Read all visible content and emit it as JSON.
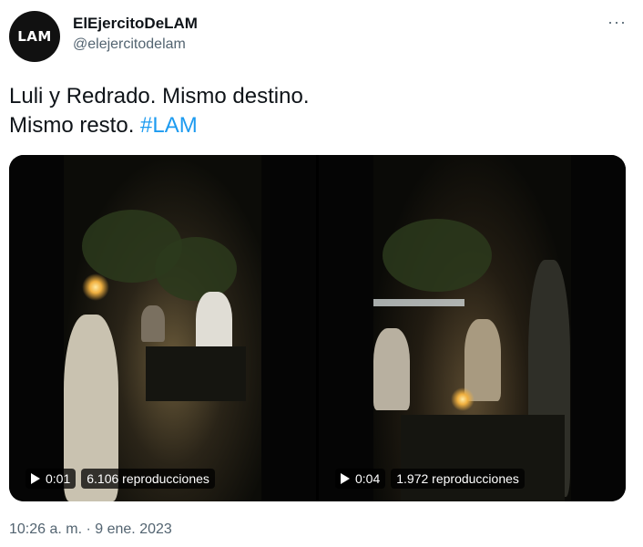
{
  "author": {
    "avatar_text": "LAM",
    "display_name": "ElEjercitoDeLAM",
    "handle": "@elejercitodelam"
  },
  "menu": {
    "more_label": "···"
  },
  "tweet": {
    "line1": "Luli y Redrado. Mismo destino.",
    "line2_text": "Mismo resto. ",
    "hashtag": "#LAM"
  },
  "videos": [
    {
      "duration": "0:01",
      "views": "6.106 reproducciones"
    },
    {
      "duration": "0:04",
      "views": "1.972 reproducciones"
    }
  ],
  "timestamp": "10:26 a. m. · 9 ene. 2023",
  "colors": {
    "link": "#1d9bf0",
    "text": "#0f1419",
    "secondary": "#536471"
  }
}
